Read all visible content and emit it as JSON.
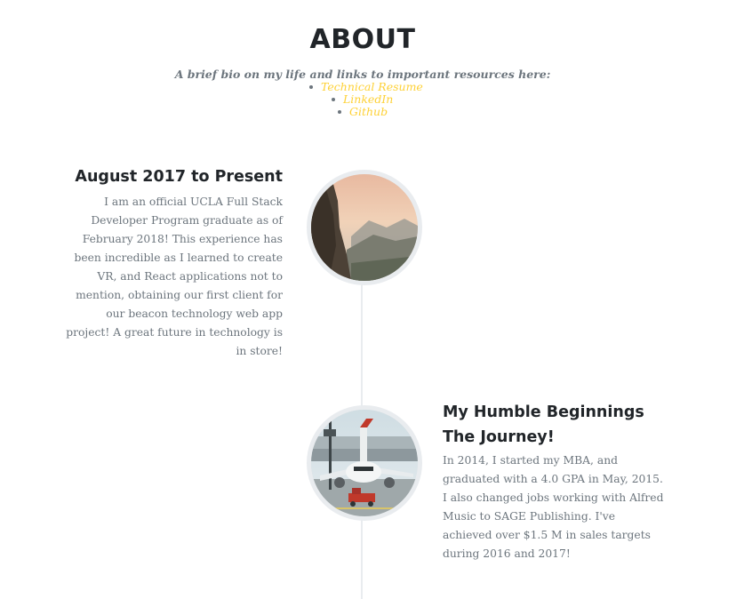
{
  "section": {
    "heading": "ABOUT",
    "subheading": "A brief bio on my life and links to important resources here:",
    "links": [
      {
        "label": "Technical Resume"
      },
      {
        "label": "LinkedIn"
      },
      {
        "label": "Github"
      }
    ]
  },
  "timeline": [
    {
      "title": "August 2017 to Present",
      "body": "I am an official UCLA Full Stack Developer Program graduate as of February 2018! This experience has been incredible as I learned to create VR, and React applications not to mention, obtaining our first client for our beacon technology web app project! A great future in technology is in store!",
      "image_icon": "mountain-landscape-photo"
    },
    {
      "title_line1": "My Humble Beginnings",
      "title_line2": "The Journey!",
      "body": "In 2014, I started my MBA, and graduated with a 4.0 GPA in May, 2015. I also changed jobs working with Alfred Music to SAGE Publishing. I've achieved over $1.5 M in sales targets during 2016 and 2017!",
      "image_icon": "airplane-photo"
    }
  ],
  "colors": {
    "heading": "#212529",
    "muted": "#6c757d",
    "link": "#fed136",
    "timeline_line": "#e9ecef"
  }
}
